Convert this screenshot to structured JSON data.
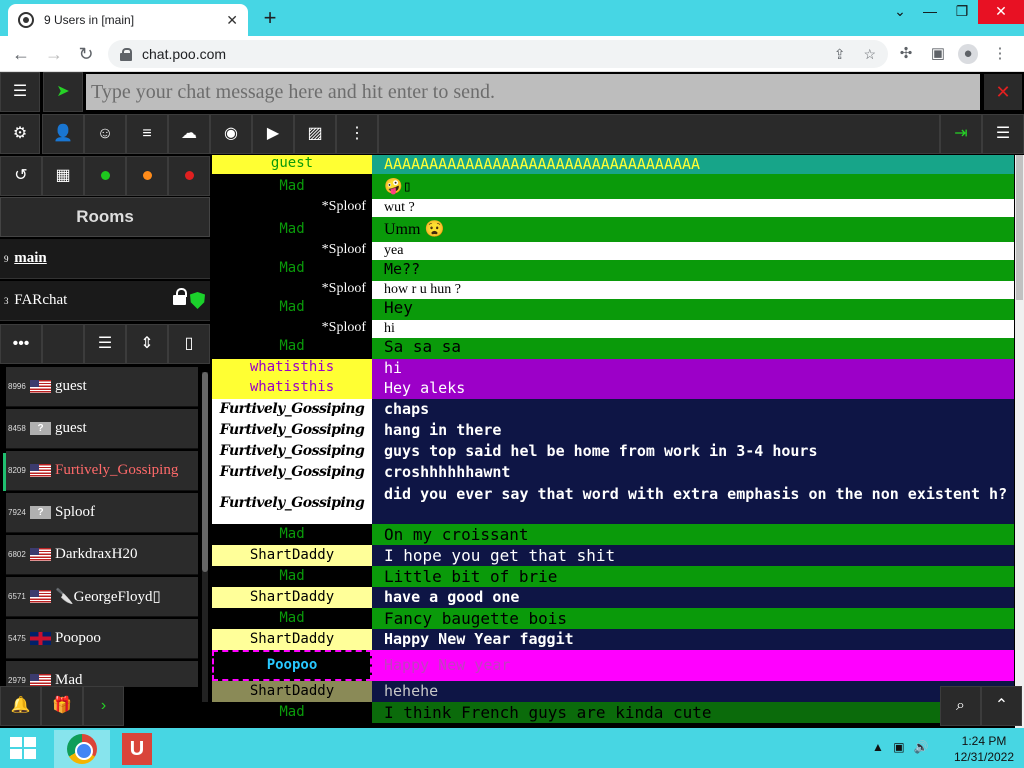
{
  "browser": {
    "tab_title": "9 Users in [main]",
    "tab_close": "✕",
    "new_tab": "+",
    "url": "chat.poo.com",
    "win_min": "⌄",
    "win_max": "❐",
    "win_close": "✕",
    "win_minimize": "—"
  },
  "toolbar": {
    "message_placeholder": "Type your chat message here and hit enter to send.",
    "close_label": "✕"
  },
  "rooms": {
    "header": "Rooms",
    "items": [
      {
        "count": "9",
        "name": "main",
        "current": true
      },
      {
        "count": "3",
        "name": "FARchat",
        "current": false
      }
    ]
  },
  "users": [
    {
      "id": "8996",
      "flag": "us",
      "name": "guest"
    },
    {
      "id": "8458",
      "flag": "unknown",
      "name": "guest"
    },
    {
      "id": "8209",
      "flag": "us",
      "name": "Furtively_Gossiping"
    },
    {
      "id": "7924",
      "flag": "unknown",
      "name": "Sploof"
    },
    {
      "id": "6802",
      "flag": "us",
      "name": "DarkdraxH20"
    },
    {
      "id": "6571",
      "flag": "us",
      "name": "🔪GeorgeFloyd▯"
    },
    {
      "id": "5475",
      "flag": "uk",
      "name": "Poopoo"
    },
    {
      "id": "2979",
      "flag": "us",
      "name": "Mad"
    }
  ],
  "messages": [
    {
      "nick": "guest",
      "text": "AAAAAAAAAAAAAAAAAAAAAAAAAAAAAAAAAAA"
    },
    {
      "nick": "Mad",
      "text": "🤪▯"
    },
    {
      "nick": "*Sploof",
      "text": "wut ?"
    },
    {
      "nick": "Mad",
      "text": "Umm 😧"
    },
    {
      "nick": "*Sploof",
      "text": "yea"
    },
    {
      "nick": "Mad",
      "text": "Me??"
    },
    {
      "nick": "*Sploof",
      "text": "how r u hun ?"
    },
    {
      "nick": "Mad",
      "text": "Hey"
    },
    {
      "nick": "*Sploof",
      "text": "hi"
    },
    {
      "nick": "Mad",
      "text": "Sa sa sa"
    },
    {
      "nick": "whatisthis",
      "text": "hi"
    },
    {
      "nick": "whatisthis",
      "text": "Hey aleks"
    },
    {
      "nick": "Furtively_Gossiping",
      "text": "chaps"
    },
    {
      "nick": "Furtively_Gossiping",
      "text": "hang in there"
    },
    {
      "nick": "Furtively_Gossiping",
      "text": "guys top said hel be home from work in 3-4 hours"
    },
    {
      "nick": "Furtively_Gossiping",
      "text": "croshhhhhhawnt"
    },
    {
      "nick": "Furtively_Gossiping",
      "text": "did you ever say that word with extra emphasis on the non existent h?"
    },
    {
      "nick": "Mad",
      "text": "On my croissant"
    },
    {
      "nick": "ShartDaddy",
      "text": "I hope you get that shit"
    },
    {
      "nick": "Mad",
      "text": "Little bit of brie"
    },
    {
      "nick": "ShartDaddy",
      "text": "have a good one"
    },
    {
      "nick": "Mad",
      "text": "Fancy baugette bois"
    },
    {
      "nick": "ShartDaddy",
      "text": "Happy New Year faggit"
    },
    {
      "nick": "Poopoo",
      "text": "Happy New year"
    },
    {
      "nick": "ShartDaddy",
      "text": "hehehe"
    },
    {
      "nick": "Mad",
      "text": "I think French guys are kinda cute"
    }
  ],
  "colors": {
    "chat_green": "#0a9a0a",
    "yellow": "#ffff33",
    "purple": "#9c00c8",
    "navy": "#0e1545",
    "magenta": "#ff00ff",
    "teal": "#17a589"
  },
  "taskbar": {
    "time": "1:24 PM",
    "date": "12/31/2022",
    "app_letter": "U"
  }
}
